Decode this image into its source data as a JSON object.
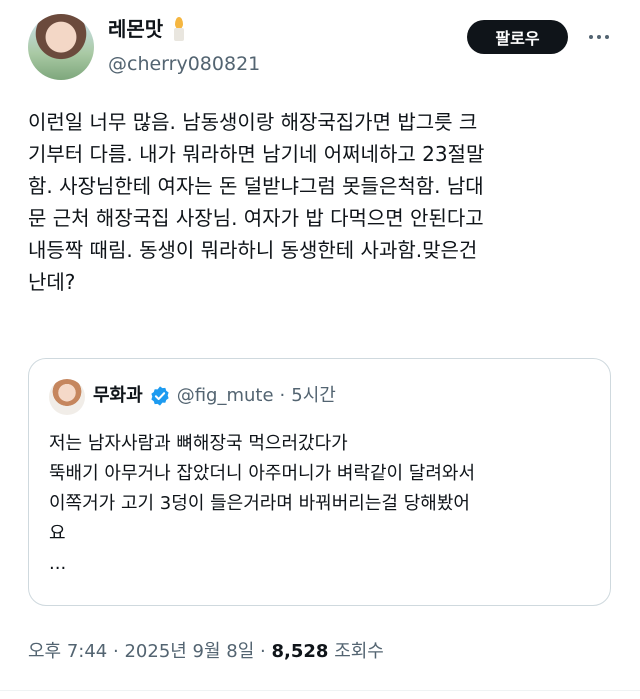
{
  "author": {
    "display_name": "레몬맛",
    "handle": "@cherry080821",
    "name_emoji": "candle-icon"
  },
  "follow_button_label": "팔로우",
  "tweet": {
    "text": "이런일 너무 많음. 남동생이랑 해장국집가면 밥그릇 크\n기부터 다름. 내가 뭐라하면 남기네 어쩌네하고 23절말\n함. 사장님한테 여자는 돈 덜받냐그럼 못들은척함. 남대\n문 근처 해장국집 사장님. 여자가 밥 다먹으면 안된다고\n내등짝 때림. 동생이 뭐라하니 동생한테 사과함.맞은건\n난데?"
  },
  "quote": {
    "name": "무화과",
    "verified": true,
    "handle": "@fig_mute",
    "separator": "·",
    "time": "5시간",
    "text": "저는 남자사람과 뼈해장국 먹으러갔다가\n뚝배기 아무거나 잡았더니 아주머니가 벼락같이 달려와서\n이쪽거가 고기 3덩이 들은거라며 바꿔버리는걸 당해봤어\n요\n..."
  },
  "meta": {
    "time": "오후 7:44",
    "dot": "·",
    "date": "2025년 9월 8일",
    "views_count": "8,528",
    "views_label": "조회수"
  },
  "colors": {
    "text": "#0f1419",
    "secondary": "#536471",
    "border": "#cfd9de",
    "verified": "#1d9bf0",
    "button_bg": "#0f1419"
  }
}
